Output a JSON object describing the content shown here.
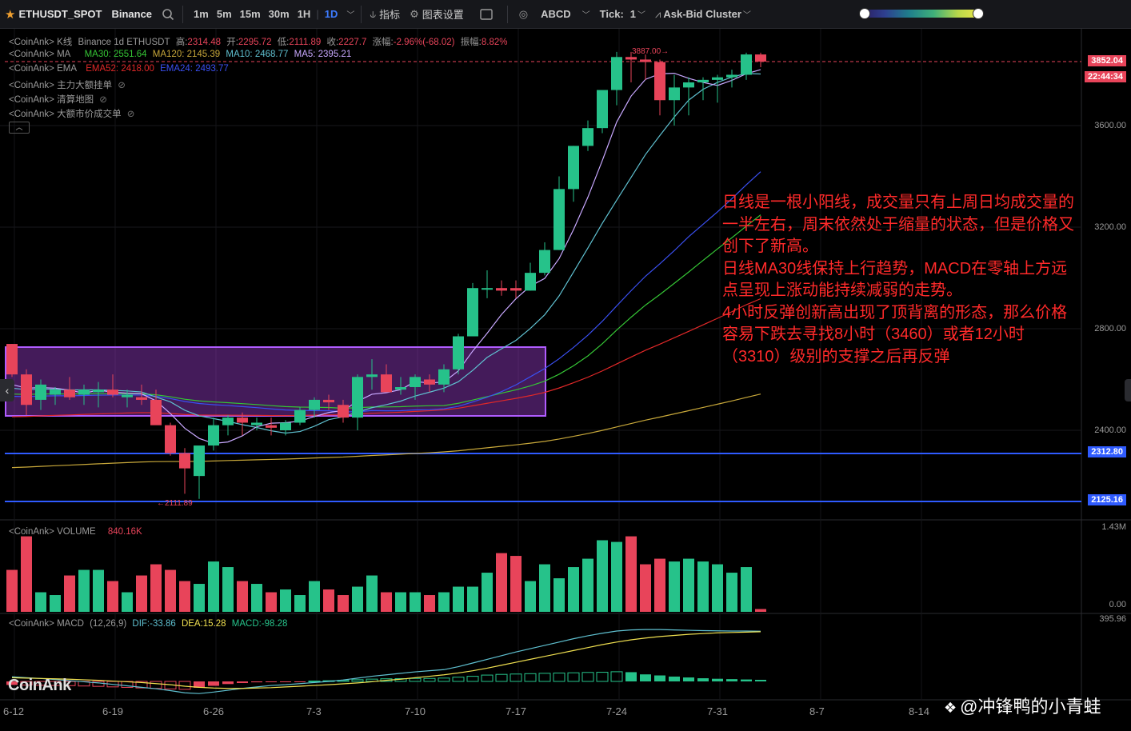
{
  "toolbar": {
    "symbol": "ETHUSDT_SPOT",
    "exchange": "Binance",
    "intervals": [
      "1m",
      "5m",
      "15m",
      "30m",
      "1H",
      "1D"
    ],
    "active_interval": "1D",
    "indicators_label": "指标",
    "chart_settings_label": "图表设置",
    "drawing_label": "ABCD",
    "tick_label": "Tick:",
    "tick_value": "1",
    "cluster_label": "Ask-Bid Cluster"
  },
  "overlays": {
    "kline": {
      "prefix": "<CoinAnk> K线",
      "source": "Binance 1d ETHUSDT",
      "high_label": "高:",
      "high": "2314.48",
      "open_label": "开:",
      "open": "2295.72",
      "low_label": "低:",
      "low": "2111.89",
      "close_label": "收:",
      "close": "2227.7",
      "chg_label": "涨幅:",
      "chg": "-2.96%(-68.02)",
      "amp_label": "振幅:",
      "amp": "8.82%"
    },
    "ma": {
      "prefix": "<CoinAnk> MA",
      "ma30": "MA30: 2551.64",
      "ma120": "MA120: 2145.39",
      "ma10": "MA10: 2468.77",
      "ma5": "MA5: 2395.21"
    },
    "ema": {
      "prefix": "<CoinAnk> EMA",
      "ema52": "EMA52: 2418.00",
      "ema24": "EMA24: 2493.77"
    },
    "big_orders": "<CoinAnk> 主力大额挂单",
    "liq_map": "<CoinAnk> 清算地图",
    "big_market": "<CoinAnk> 大额市价成交单"
  },
  "price_axis": {
    "ticks": [
      "3600.00",
      "3200.00",
      "2800.00",
      "2400.00"
    ],
    "current_price": "3852.04",
    "countdown": "22:44:34",
    "hline1": "2312.80",
    "hline2": "2125.16",
    "high_marker": "3887.00",
    "low_marker": "2111.89"
  },
  "volume_panel": {
    "label": "<CoinAnk> VOLUME",
    "value": "840.16K",
    "max": "1.43M",
    "min": "0.00"
  },
  "macd_panel": {
    "label": "<CoinAnk> MACD",
    "params": "(12,26,9)",
    "dif": "DIF:-33.86",
    "dea": "DEA:15.28",
    "macd": "MACD:-98.28",
    "top": "395.96"
  },
  "x_axis": [
    "6-12",
    "6-19",
    "6-26",
    "7-3",
    "7-10",
    "7-17",
    "7-24",
    "7-31",
    "8-7",
    "8-14"
  ],
  "note_lines": [
    "日线是一根小阳线，成交量只有上周日均成交量的一半左右，周末依然处于缩量的状态，但是价格又创下了新高。",
    "日线MA30线保持上行趋势，MACD在零轴上方远点呈现上涨动能持续减弱的走势。",
    "4小时反弹创新高出现了顶背离的形态，那么价格容易下跌去寻找8小时（3460）或者12小时（3310）级别的支撑之后再反弹"
  ],
  "watermark": "CoinAnk",
  "author": "@冲锋鸭的小青蛙",
  "colors": {
    "up": "#26c28a",
    "down": "#e8445a",
    "bg": "#000000",
    "box": "#b05cff",
    "hline": "#2f5bff"
  },
  "chart_data": {
    "type": "candlestick",
    "ohlc": [
      [
        2740,
        2740,
        2610,
        2620
      ],
      [
        2620,
        2640,
        2460,
        2500
      ],
      [
        2520,
        2600,
        2480,
        2580
      ],
      [
        2540,
        2570,
        2500,
        2560
      ],
      [
        2560,
        2610,
        2520,
        2530
      ],
      [
        2540,
        2580,
        2500,
        2560
      ],
      [
        2550,
        2590,
        2490,
        2560
      ],
      [
        2560,
        2620,
        2530,
        2540
      ],
      [
        2530,
        2560,
        2490,
        2540
      ],
      [
        2530,
        2580,
        2500,
        2520
      ],
      [
        2520,
        2560,
        2440,
        2420
      ],
      [
        2420,
        2430,
        2300,
        2310
      ],
      [
        2310,
        2330,
        2150,
        2250
      ],
      [
        2220,
        2330,
        2130,
        2340
      ],
      [
        2340,
        2450,
        2320,
        2420
      ],
      [
        2420,
        2460,
        2380,
        2450
      ],
      [
        2450,
        2470,
        2380,
        2430
      ],
      [
        2420,
        2450,
        2400,
        2430
      ],
      [
        2420,
        2450,
        2380,
        2410
      ],
      [
        2400,
        2440,
        2380,
        2430
      ],
      [
        2430,
        2490,
        2420,
        2480
      ],
      [
        2480,
        2530,
        2450,
        2520
      ],
      [
        2520,
        2540,
        2480,
        2510
      ],
      [
        2500,
        2520,
        2430,
        2450
      ],
      [
        2450,
        2620,
        2400,
        2610
      ],
      [
        2610,
        2680,
        2560,
        2620
      ],
      [
        2620,
        2660,
        2570,
        2550
      ],
      [
        2560,
        2610,
        2540,
        2570
      ],
      [
        2570,
        2620,
        2520,
        2610
      ],
      [
        2600,
        2620,
        2550,
        2580
      ],
      [
        2580,
        2660,
        2550,
        2640
      ],
      [
        2640,
        2780,
        2620,
        2770
      ],
      [
        2770,
        2980,
        2770,
        2960
      ],
      [
        2960,
        3030,
        2920,
        2960
      ],
      [
        2960,
        2990,
        2930,
        2950
      ],
      [
        2960,
        2990,
        2920,
        2950
      ],
      [
        2950,
        3060,
        2950,
        3020
      ],
      [
        3020,
        3140,
        3010,
        3110
      ],
      [
        3110,
        3400,
        3110,
        3350
      ],
      [
        3350,
        3520,
        3300,
        3520
      ],
      [
        3520,
        3620,
        3500,
        3590
      ],
      [
        3590,
        3720,
        3570,
        3740
      ],
      [
        3740,
        3890,
        3680,
        3870
      ],
      [
        3870,
        3890,
        3770,
        3860
      ],
      [
        3860,
        3880,
        3780,
        3850
      ],
      [
        3850,
        3860,
        3640,
        3700
      ],
      [
        3700,
        3800,
        3600,
        3750
      ],
      [
        3750,
        3790,
        3640,
        3770
      ],
      [
        3770,
        3790,
        3700,
        3780
      ],
      [
        3780,
        3800,
        3690,
        3790
      ],
      [
        3790,
        3820,
        3750,
        3800
      ],
      [
        3800,
        3887,
        3780,
        3880
      ],
      [
        3880,
        3887,
        3830,
        3852
      ]
    ],
    "volume": [
      0.75,
      1.35,
      0.35,
      0.3,
      0.65,
      0.75,
      0.75,
      0.55,
      0.35,
      0.65,
      0.85,
      0.75,
      0.55,
      0.5,
      0.9,
      0.8,
      0.55,
      0.5,
      0.35,
      0.4,
      0.3,
      0.55,
      0.4,
      0.3,
      0.45,
      0.65,
      0.35,
      0.35,
      0.35,
      0.3,
      0.35,
      0.45,
      0.45,
      0.7,
      1.05,
      1.0,
      0.55,
      0.85,
      0.6,
      0.8,
      0.95,
      1.28,
      1.25,
      1.35,
      0.85,
      0.95,
      0.9,
      0.95,
      0.9,
      0.85,
      0.7,
      0.8,
      0.05
    ],
    "macd_hist": [
      -40,
      -42,
      -44,
      -46,
      -48,
      -52,
      -56,
      -62,
      -68,
      -74,
      -80,
      -86,
      -90,
      -72,
      -50,
      -30,
      -18,
      -10,
      -6,
      -4,
      -2,
      4,
      8,
      12,
      20,
      26,
      30,
      32,
      34,
      34,
      38,
      48,
      58,
      72,
      80,
      84,
      88,
      92,
      95,
      98,
      102,
      104,
      110,
      105,
      80,
      68,
      55,
      45,
      36,
      30,
      26,
      22,
      18
    ],
    "dif": [
      25,
      20,
      16,
      10,
      4,
      -2,
      -8,
      -16,
      -24,
      -32,
      -40,
      -50,
      -62,
      -66,
      -58,
      -48,
      -38,
      -30,
      -22,
      -18,
      -12,
      -6,
      0,
      8,
      18,
      28,
      36,
      44,
      52,
      58,
      64,
      80,
      100,
      120,
      140,
      160,
      178,
      196,
      214,
      232,
      248,
      262,
      274,
      280,
      282,
      282,
      280,
      278,
      276,
      275,
      274,
      274,
      273
    ],
    "dea": [
      20,
      18,
      16,
      14,
      12,
      9,
      6,
      2,
      -2,
      -6,
      -12,
      -18,
      -26,
      -32,
      -36,
      -38,
      -38,
      -36,
      -34,
      -30,
      -26,
      -22,
      -18,
      -13,
      -8,
      -2,
      6,
      12,
      20,
      28,
      36,
      46,
      58,
      72,
      88,
      104,
      120,
      136,
      152,
      168,
      184,
      200,
      214,
      226,
      236,
      244,
      250,
      256,
      260,
      264,
      266,
      268,
      270
    ]
  }
}
